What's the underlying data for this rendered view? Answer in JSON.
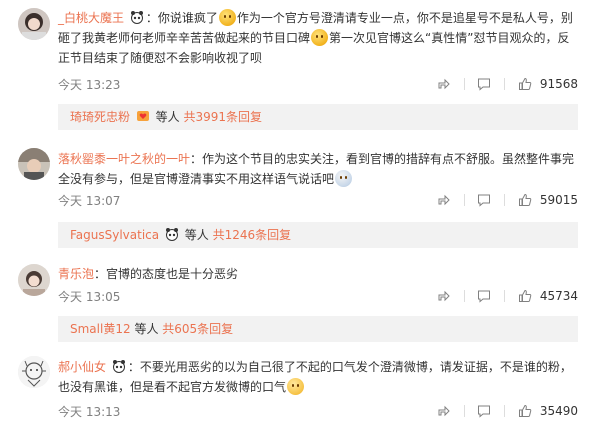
{
  "comments": [
    {
      "user": "_白桃大魔王",
      "colon": "：",
      "text1": "你说谁疯了",
      "text2": "作为一个官方号澄清请专业一点，你不是追星号不是私人号，别砸了我黄老师何老师辛辛苦苦做起来的节目口碑",
      "text3": "第一次见官博这么“真性情”怼节目观众的，反正节目结束了随便怼不会影响收视了呗",
      "time": "今天 13:23",
      "likes": "91568",
      "reply": {
        "user": "琦琦死忠粉",
        "middle": "等人",
        "count": "共3991条回复"
      }
    },
    {
      "user": "落秋罂黍一叶之秋的一叶",
      "colon": "：",
      "text1": "作为这个节目的忠实关注，看到官博的措辞有点不舒服。虽然整件事完全没有参与，但是官博澄清事实不用这样语气说话吧",
      "time": "今天 13:07",
      "likes": "59015",
      "reply": {
        "user": "FagusSylvatica",
        "middle": "等人",
        "count": "共1246条回复"
      }
    },
    {
      "user": "青乐泡",
      "colon": "：",
      "text1": "官博的态度也是十分恶劣",
      "time": "今天 13:05",
      "likes": "45734",
      "reply": {
        "user": "Small黄12",
        "middle": "等人",
        "count": "共605条回复"
      }
    },
    {
      "user": "郝小仙女",
      "colon": "：",
      "text1": "不要光用恶劣的以为自己很了不起的口气发个澄清微博，请发证据，不是谁的粉，也没有黑谁，但是看不起官方发微博的口气",
      "time": "今天 13:13",
      "likes": "35490"
    }
  ],
  "icons": {
    "share": "share-icon",
    "comment": "comment-icon",
    "like": "thumbs-up-icon",
    "user_badge": "panda-icon",
    "fan_badge": "fan-heart-icon"
  },
  "colors": {
    "username": "#eb7350",
    "time": "#808080",
    "reply_bg": "#f2f2f2"
  }
}
